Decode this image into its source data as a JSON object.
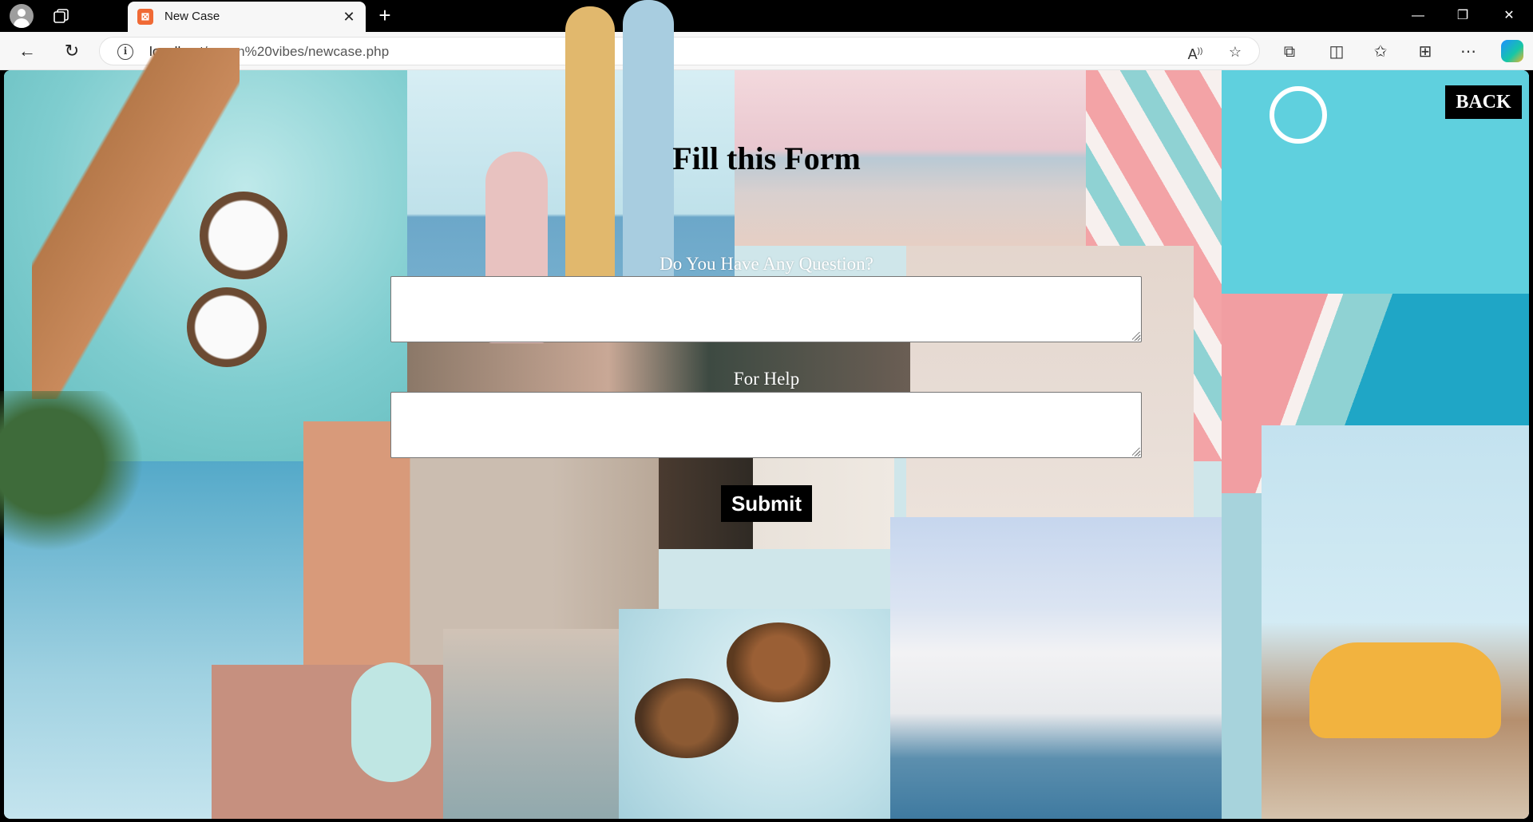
{
  "browser": {
    "tab": {
      "title": "New Case",
      "favicon": "xampp-icon"
    },
    "url": {
      "host": "localhost",
      "path": "/ocean%20vibes/newcase.php"
    }
  },
  "page": {
    "back_label": "BACK",
    "title": "Fill this Form",
    "question_label": "Do You Have Any Question?",
    "question_value": "",
    "help_label": "For Help",
    "help_value": "",
    "submit_label": "Submit"
  },
  "colors": {
    "button_bg": "#000000",
    "button_text": "#ffffff",
    "label_text": "#ffffff",
    "title_text": "#000000"
  }
}
